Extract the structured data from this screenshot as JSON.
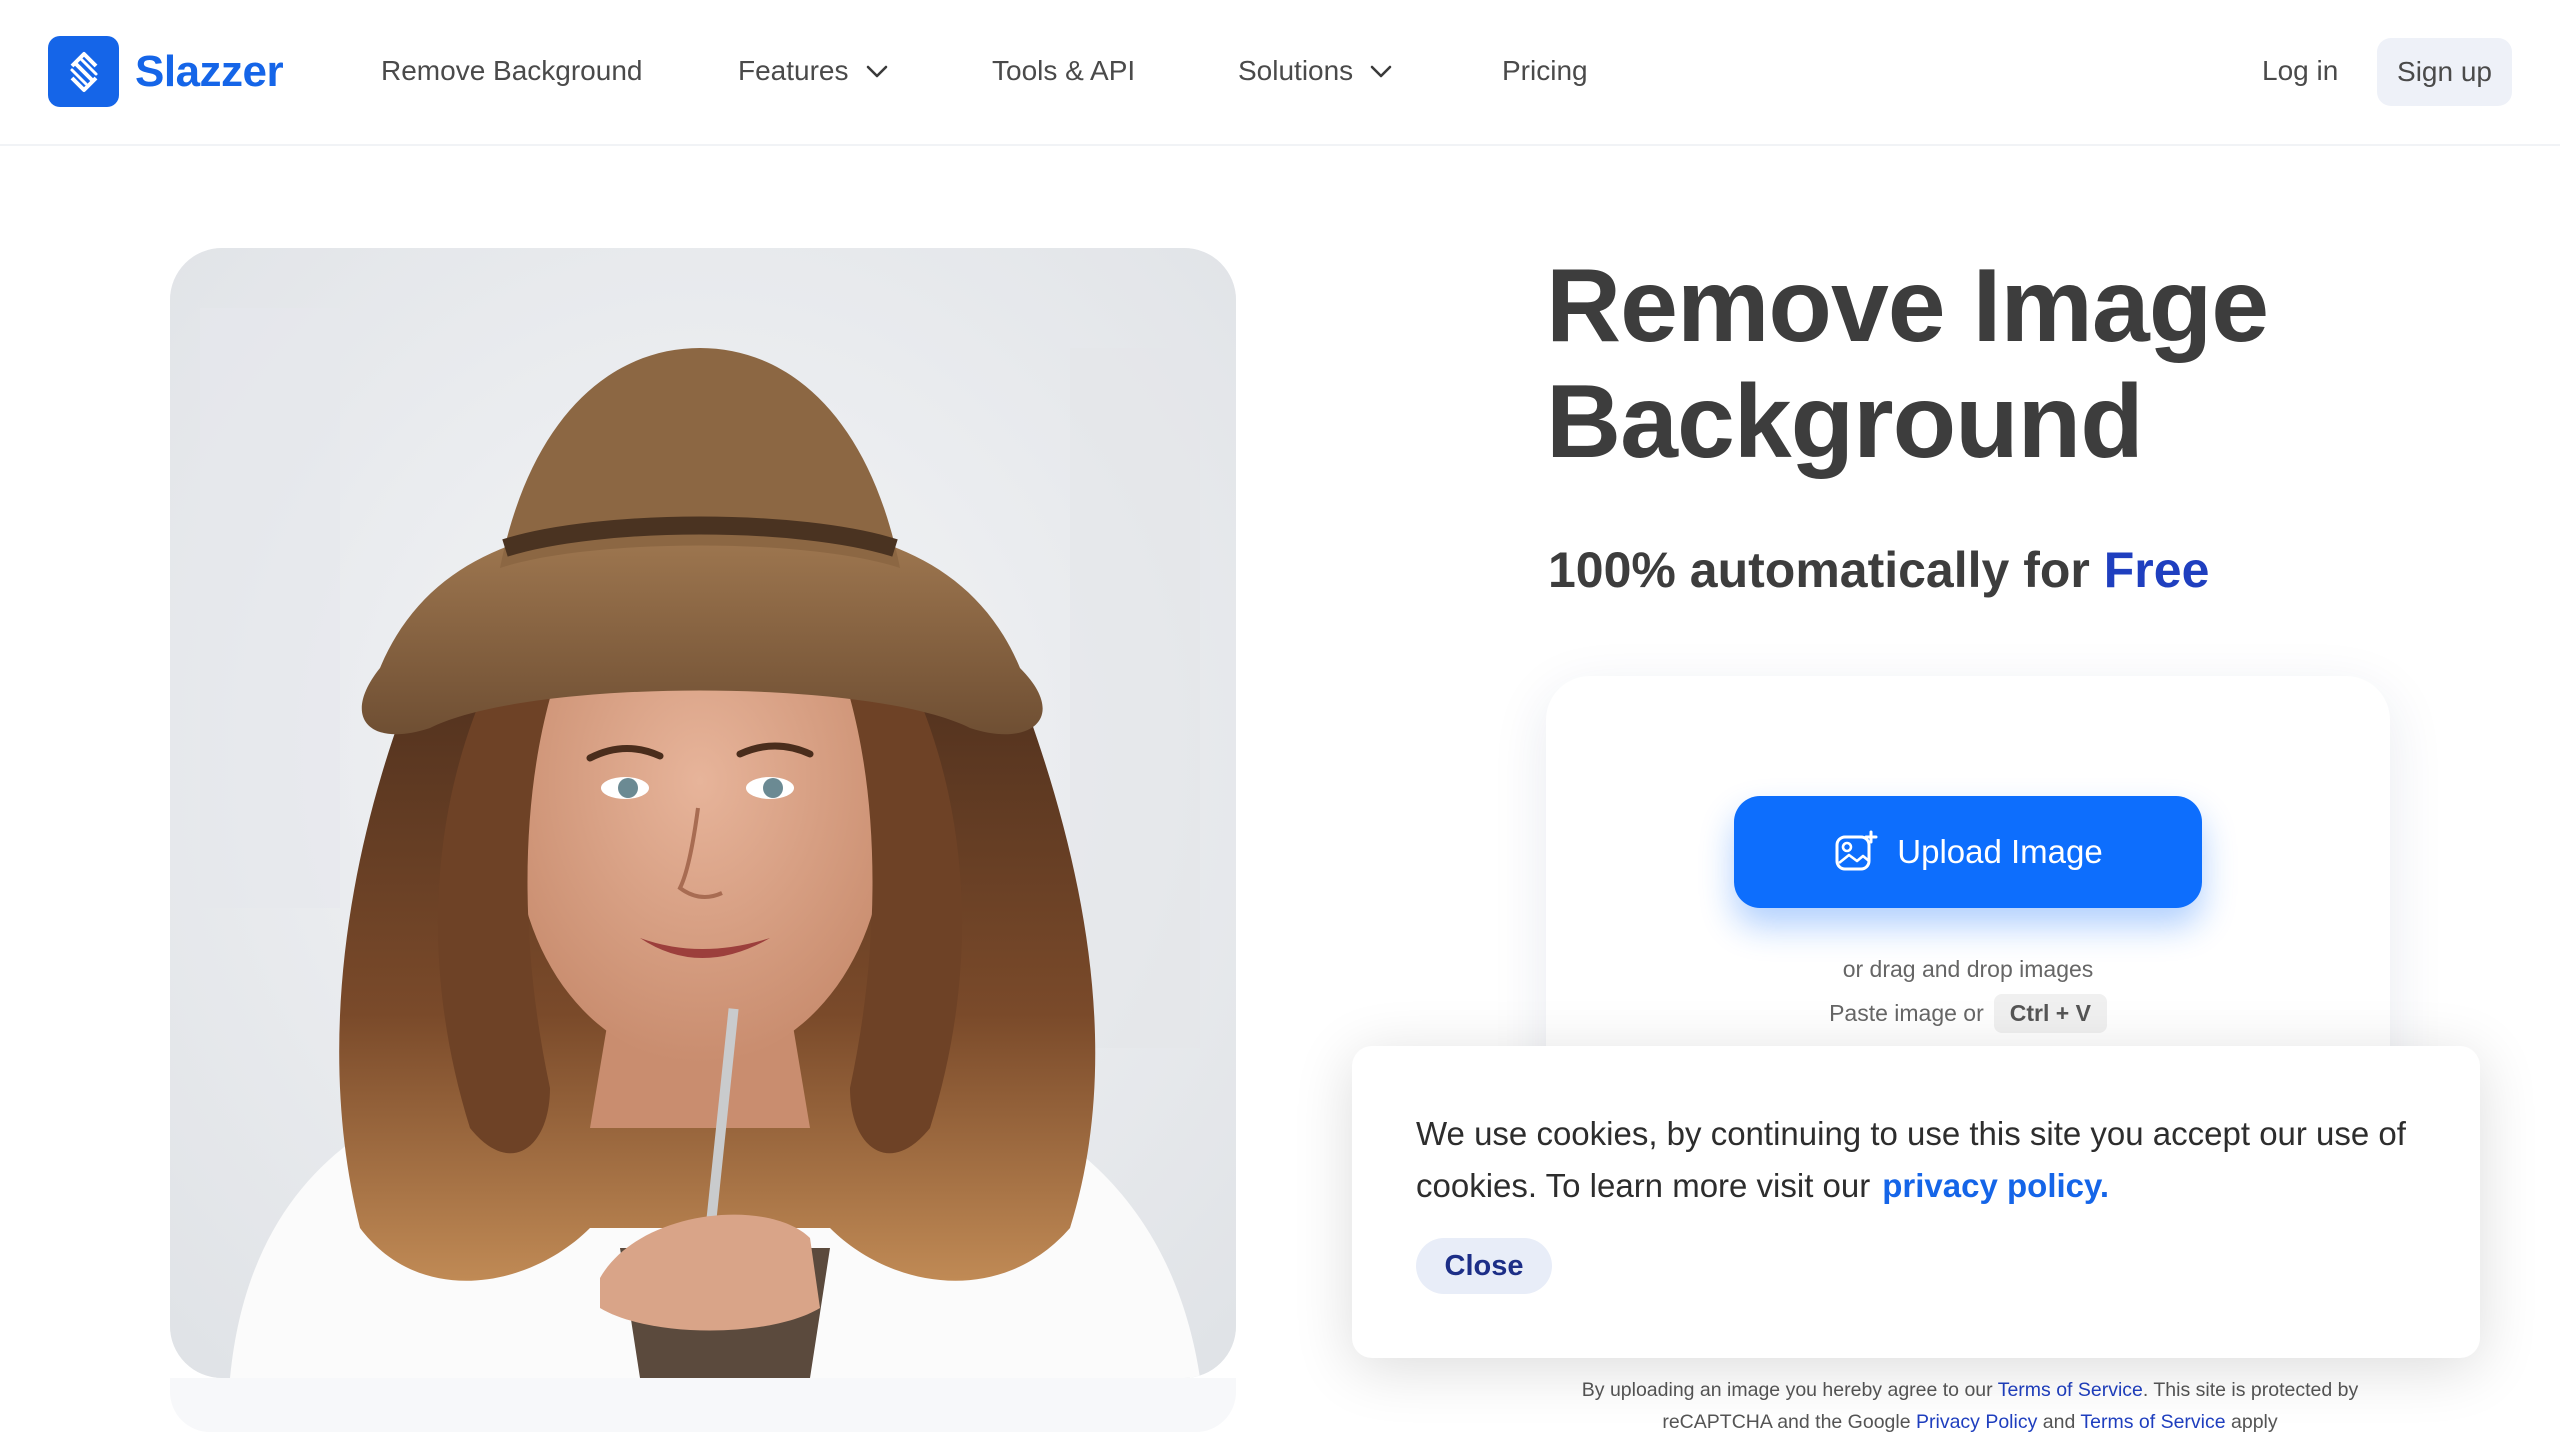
{
  "brand": {
    "name": "Slazzer",
    "accent": "#1565e8"
  },
  "nav": {
    "items": [
      {
        "label": "Remove Background"
      },
      {
        "label": "Features"
      },
      {
        "label": "Tools & API"
      },
      {
        "label": "Solutions"
      },
      {
        "label": "Pricing"
      }
    ],
    "login": "Log in",
    "signup": "Sign up"
  },
  "hero": {
    "title_line1": "Remove Image",
    "title_line2": "Background",
    "subtitle_prefix": "100% automatically for ",
    "subtitle_highlight": "Free",
    "image_icon": "woman-with-hat-photo"
  },
  "upload": {
    "button_label": "Upload Image",
    "button_icon": "image-add-icon",
    "drag_text": "or drag and drop images",
    "paste_text": "Paste image or",
    "shortcut": "Ctrl + V",
    "button_color": "#0d6efd"
  },
  "terms": {
    "part1": "By uploading an image you hereby agree to our ",
    "tos_link": "Terms of Service",
    "part2": ". This site is protected by reCAPTCHA and the Google ",
    "privacy_link": "Privacy Policy",
    "part3": " and ",
    "tos_link2": "Terms of Service",
    "part4": " apply"
  },
  "cookie": {
    "message": "We use cookies, by continuing to use this site you accept our use of cookies.  To learn more visit our",
    "policy_link": "privacy policy.",
    "close_label": "Close"
  }
}
